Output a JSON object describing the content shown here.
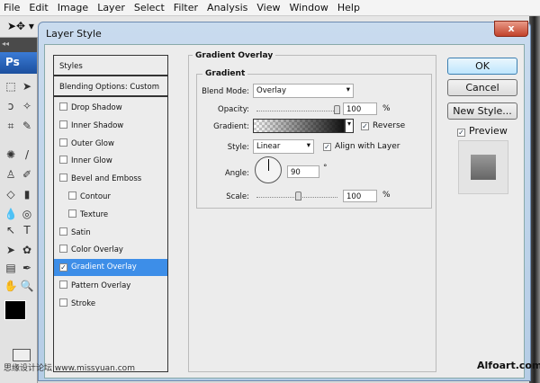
{
  "menu": [
    "File",
    "Edit",
    "Image",
    "Layer",
    "Select",
    "Filter",
    "Analysis",
    "View",
    "Window",
    "Help"
  ],
  "tools_header": "Ps",
  "dialog": {
    "title": "Layer Style",
    "close": "x",
    "styles_list": {
      "styles": "Styles",
      "blending": "Blending Options: Custom",
      "items": [
        {
          "label": "Drop Shadow",
          "checked": false,
          "indent": false
        },
        {
          "label": "Inner Shadow",
          "checked": false,
          "indent": false
        },
        {
          "label": "Outer Glow",
          "checked": false,
          "indent": false
        },
        {
          "label": "Inner Glow",
          "checked": false,
          "indent": false
        },
        {
          "label": "Bevel and Emboss",
          "checked": false,
          "indent": false
        },
        {
          "label": "Contour",
          "checked": false,
          "indent": true
        },
        {
          "label": "Texture",
          "checked": false,
          "indent": true
        },
        {
          "label": "Satin",
          "checked": false,
          "indent": false
        },
        {
          "label": "Color Overlay",
          "checked": false,
          "indent": false
        },
        {
          "label": "Gradient Overlay",
          "checked": true,
          "indent": false,
          "selected": true
        },
        {
          "label": "Pattern Overlay",
          "checked": false,
          "indent": false
        },
        {
          "label": "Stroke",
          "checked": false,
          "indent": false
        }
      ]
    },
    "panel": {
      "title": "Gradient Overlay",
      "group": "Gradient",
      "blend_mode_label": "Blend Mode:",
      "blend_mode": "Overlay",
      "opacity_label": "Opacity:",
      "opacity": "100",
      "opacity_unit": "%",
      "gradient_label": "Gradient:",
      "reverse_label": "Reverse",
      "reverse": true,
      "style_label": "Style:",
      "style": "Linear",
      "align_label": "Align with Layer",
      "align": true,
      "angle_label": "Angle:",
      "angle": "90",
      "angle_unit": "°",
      "scale_label": "Scale:",
      "scale": "100",
      "scale_unit": "%"
    },
    "buttons": {
      "ok": "OK",
      "cancel": "Cancel",
      "new_style": "New Style...",
      "preview": "Preview",
      "preview_checked": true
    }
  },
  "watermark_left": "思缘设计论坛 www.missyuan.com",
  "watermark_right": "Alfoart.com",
  "accent": "#3d8ee8"
}
